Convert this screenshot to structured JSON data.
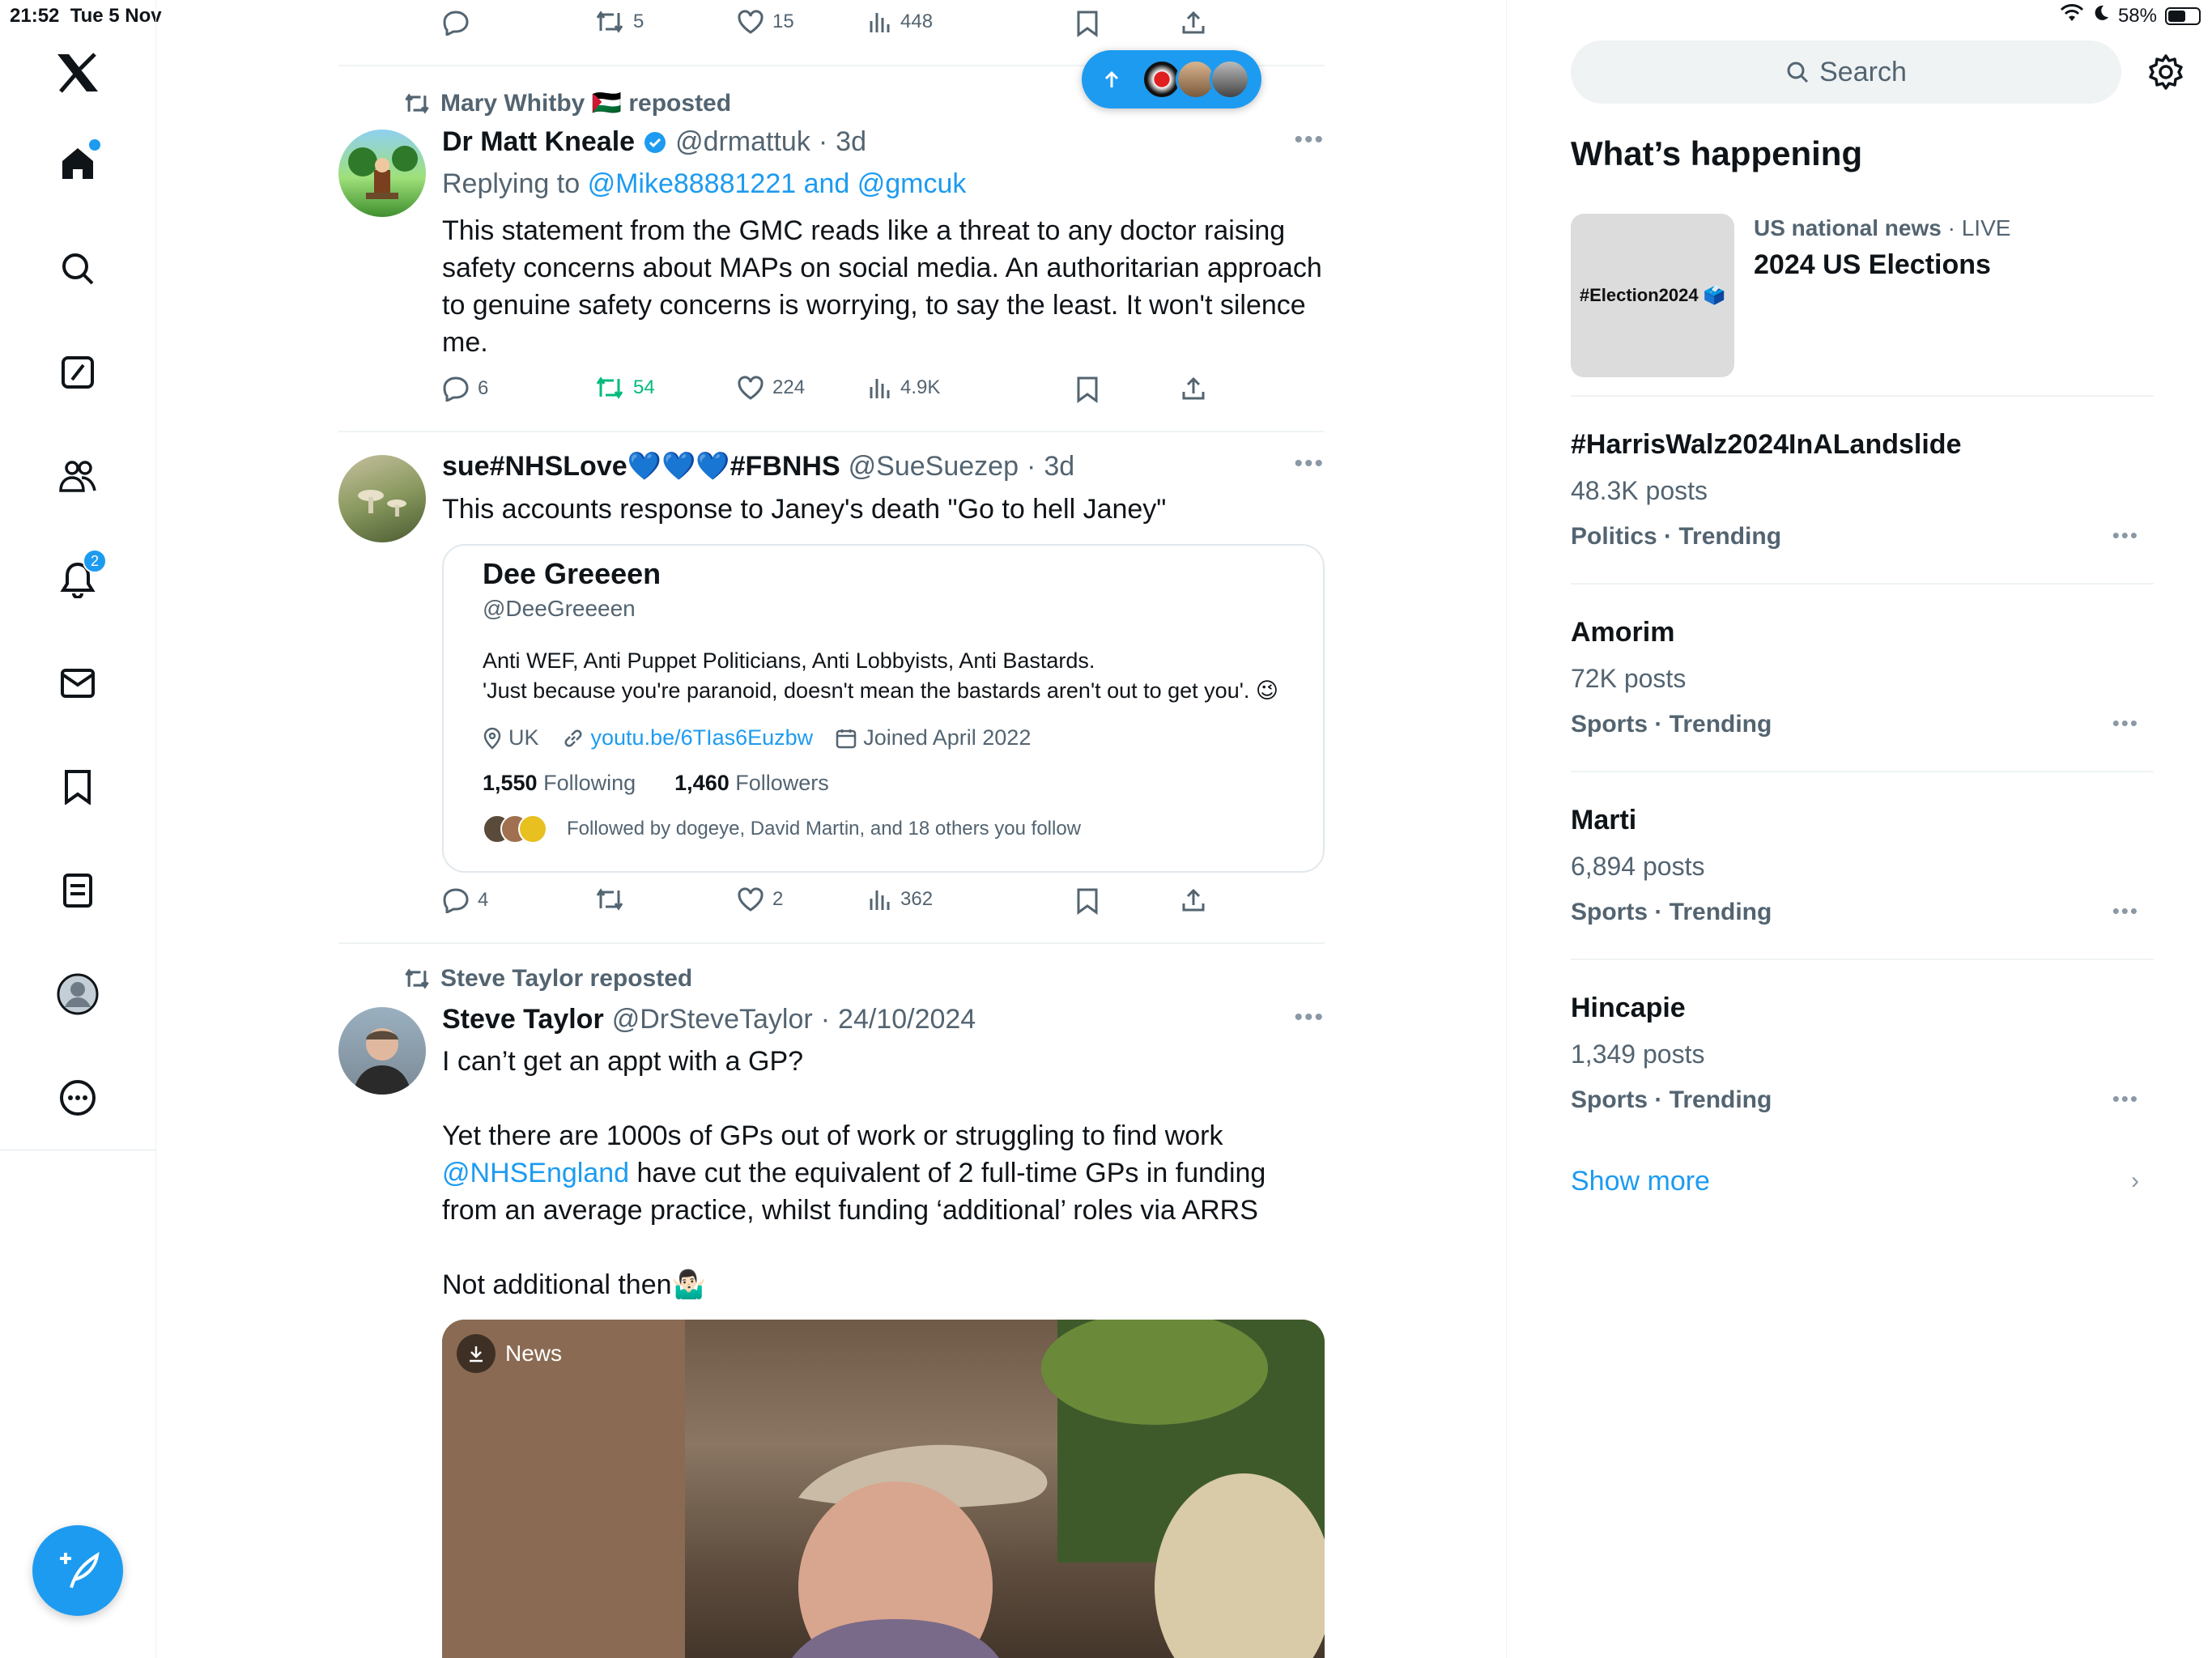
{
  "status_bar": {
    "time": "21:52",
    "date": "Tue 5 Nov",
    "battery": "58%",
    "battery_level": 0.58
  },
  "nav": {
    "notifications_badge": "2"
  },
  "top_actions": {
    "replies": "",
    "reposts": "5",
    "likes": "15",
    "views": "448"
  },
  "tweets": [
    {
      "repost_by": "Mary Whitby 🇵🇸 reposted",
      "name": "Dr Matt Kneale",
      "handle": "@drmattuk",
      "sep": "·",
      "time": "3d",
      "reply_prefix": "Replying to",
      "reply_to": "@Mike88881221 and @gmcuk",
      "text": "This statement from the GMC reads like a threat to any doctor raising safety concerns about MAPs on social media. An authoritarian approach to genuine safety concerns is worrying, to say the least. It won't silence me.",
      "replies": "6",
      "reposts": "54",
      "likes": "224",
      "views": "4.9K"
    },
    {
      "name": "sue#NHSLove💙💙💙#FBNHS",
      "handle": "@SueSuezep",
      "sep": "·",
      "time": "3d",
      "text": "This  accounts response to Janey's death \"Go to hell Janey\"",
      "card": {
        "name": "Dee Greeeen",
        "handle": "@DeeGreeeen",
        "bio_line1": "Anti WEF, Anti Puppet Politicians, Anti Lobbyists, Anti Bastards.",
        "bio_line2": "'Just because you're paranoid, doesn't mean the bastards aren't out to get you'. 😉",
        "location": "UK",
        "url": "youtu.be/6TIas6Euzbw",
        "joined": "Joined April 2022",
        "following_count": "1,550",
        "following_label": "Following",
        "followers_count": "1,460",
        "followers_label": "Followers",
        "followed_by": "Followed by dogeye, David Martin, and 18 others you follow"
      },
      "replies": "4",
      "reposts": "",
      "likes": "2",
      "views": "362"
    },
    {
      "repost_by": "Steve Taylor reposted",
      "name": "Steve Taylor",
      "handle": "@DrSteveTaylor",
      "sep": "·",
      "time": "24/10/2024",
      "line1": "I can’t get an appt with a GP?",
      "line2": "Yet there are 1000s of GPs out of work or struggling to find work",
      "mention": "@NHSEngland",
      "line3": " have cut the equivalent of 2 full-time GPs in funding from an average practice, whilst funding ‘additional’ roles via ARRS",
      "line4": "Not additional then🤷🏻‍♂️",
      "media_label": "News"
    }
  ],
  "sidebar": {
    "search_placeholder": "Search",
    "title": "What’s happening",
    "news": {
      "thumb_text": "#Election2024 🗳️",
      "source": "US national news",
      "live": "· LIVE",
      "title": "2024 US Elections"
    },
    "trends": [
      {
        "name": "#HarrisWalz2024InALandslide",
        "posts": "48.3K posts",
        "category": "Politics · Trending"
      },
      {
        "name": "Amorim",
        "posts": "72K posts",
        "category": "Sports · Trending"
      },
      {
        "name": "Marti",
        "posts": "6,894 posts",
        "category": "Sports · Trending"
      },
      {
        "name": "Hincapie",
        "posts": "1,349 posts",
        "category": "Sports · Trending"
      }
    ],
    "show_more": "Show more"
  },
  "colors": {
    "accent": "#1d9bf0",
    "repost_active": "#00ba7c",
    "muted": "#536471"
  }
}
